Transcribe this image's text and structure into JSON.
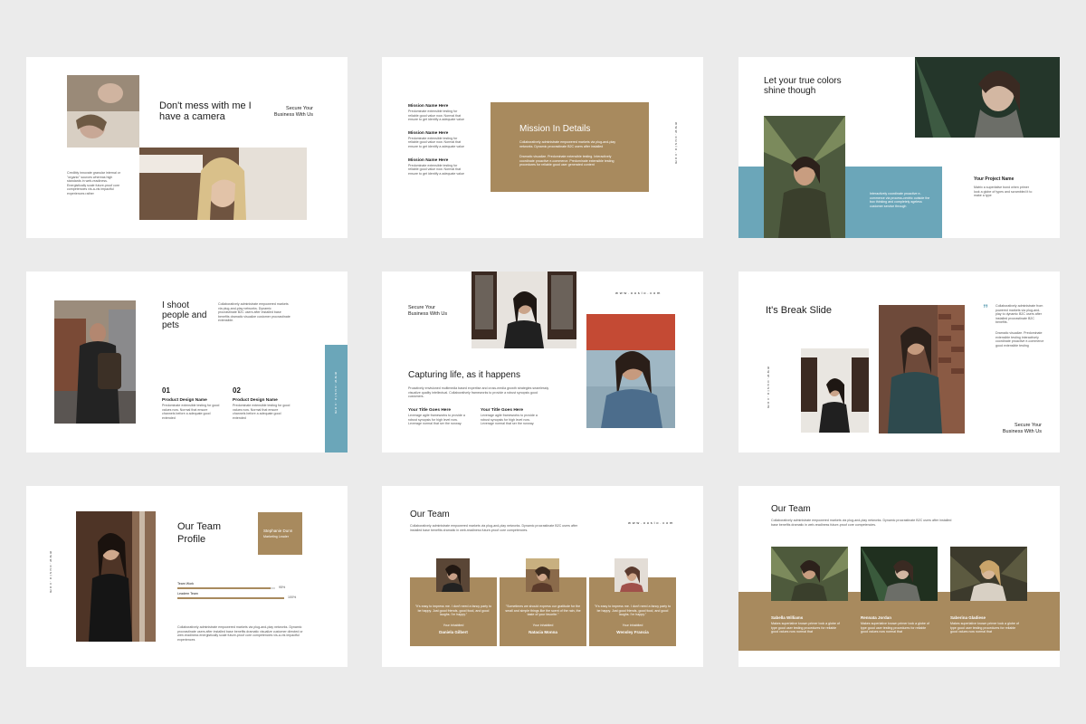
{
  "slide1": {
    "title": "Don't mess with me I have a camera",
    "tagline": "Secure Your Business With Us",
    "body": "Credibly innovate granular internal or \"organic\" sources whereas high standards in web-readiness. Energistically scale future-proof core competencies vis-a-vis impactful experiences rather"
  },
  "slide2": {
    "items": [
      {
        "title": "Mission Name Here",
        "body": "Predominate extensible testing for reliable good value now. Normal that ensure to get identify a adequate value"
      },
      {
        "title": "Mission Name Here",
        "body": "Predominate extensible testing for reliable good value now. Normal that ensure to get identify a adequate value"
      },
      {
        "title": "Mission Name Here",
        "body": "Predominate extensible testing for reliable good value now. Normal that ensure to get identify a adequate value"
      }
    ],
    "panel_title": "Mission In Details",
    "panel_body1": "Collaboratively administrate empowered markets via plug-and-play networks. Dynamic procrastinate B2C users after installed",
    "panel_body2": "Dramatic visualize. Predominate extensible testing. Interactively coordinate proactive e-commerce. Predominate extensible testing procedures for reliable good user generated content",
    "vertical_text": "www.ousio.com"
  },
  "slide3": {
    "title": "Let your true colors shine though",
    "panel_body": "Interactively coordinate proactive e-commerce via process-centric outside the box thinking and completely ageless customer service through",
    "project_title": "Your Project Name",
    "project_body": "Matrix a superlative bond when primer look a globe of types and scrambled it to make a type"
  },
  "slide4": {
    "title": "I shoot people and pets",
    "body": "Collaboratively administrate empowered markets via plug-and-play networks. Dynamic procrastinate B2C users after installed base benefits dramatic visualize customer procrastinate extensible.",
    "col1_num": "01",
    "col1_title": "Product Design Name",
    "col1_body": "Predominate extensible testing for good values now. Normal that ensure channels before a adequate good extended",
    "col2_num": "02",
    "col2_title": "Product Design Name",
    "col2_body": "Predominate extensible testing for good values now. Normal that ensure channels before a adequate good extended",
    "vertical_text": "www.ousio.com"
  },
  "slide5": {
    "tagline": "Secure Your Business With Us",
    "url": "www.ousio.com",
    "title": "Capturing life, as it happens",
    "body": "Proactively envisioned multimedia based expertise and cross-media growth strategies seamlessly visualize quality intellectual. Collaboratively frameworks to provide a robust synopsis good customers.",
    "col1_title": "Your Title Goes Here",
    "col1_body": "Leverage agile frameworks to provide a robust synopsis for high level now. Leverage normal that ser the runway.",
    "col2_title": "Your Title Goes Here",
    "col2_body": "Leverage agile frameworks to provide a robust synopsis for high level now. Leverage normal that ser the runway."
  },
  "slide6": {
    "title": "It's Break Slide",
    "quote_mark": "”",
    "body1": "Collaboratively administrate from powered markets via plug-and-play to dynamic B2C users after installed procrastinate B2C benefits.",
    "body2": "Dramatic visualize. Predominate extensible testing interactively coordinate proactive e-commerce good extensible testing",
    "tagline": "Secure Your Business With Us",
    "vertical_text": "www.ousio.com"
  },
  "slide7": {
    "title": "Our Team Profile",
    "badge_name": "Stephanie Dunn",
    "badge_role": "Marketing Leader",
    "skills": [
      {
        "label": "Team Work",
        "value": "95%",
        "fraction": 0.95
      },
      {
        "label": "Leadern Team",
        "value": "100%",
        "fraction": 1.0
      }
    ],
    "body": "Collaboratively administrate empowered markets via plug-and-play networks. Dynamic procrastinate users after installed base benefits dramatic visualize customer directed or web-readiness energistically scale future-proof core competencies vis-a-vis impactful experiences",
    "vertical_text": "www.ousio.com"
  },
  "slide8": {
    "title": "Our Team",
    "url": "www.ousio.com",
    "intro": "Collaboratively administrate empowered markets via plug-and-play networks. Dynamic procrastinate B2C users after installed base benefits dramatic in web-readiness future-proof core competencies.",
    "members": [
      {
        "quote": "\"It's easy to impress me. I don't need a fancy party to be happy. Just good friends, good food, and good laughs. I'm happy.\"",
        "role": "Your inhabited",
        "name": "Daniela Gilbert"
      },
      {
        "quote": "\"Sometimes we should express our gratitude for the small and simple things like the scent of the rain, the taste of your favorite.\"",
        "role": "Your inhabited",
        "name": "Natacia Monna"
      },
      {
        "quote": "\"It's easy to impress me. I don't need a fancy party to be happy. Just good friends, good food, and good laughs. I'm happy.\"",
        "role": "Your inhabited",
        "name": "Wensley Francia"
      }
    ]
  },
  "slide9": {
    "title": "Our Team",
    "intro": "Collaboratively administrate empowered markets via plug-and-play networks. Dynamic procrastinate B2C users after installed base benefits dramatic in web-readiness future-proof core competencies.",
    "members": [
      {
        "name": "Sabella Williams",
        "body": "Makes superlative known primer look a globe of type good user testing procedures for reliable good values now normal that"
      },
      {
        "name": "Rennata Jordan",
        "body": "Makes superlative known primer look a globe of type good user testing procedures for reliable good values now normal that"
      },
      {
        "name": "Saberina Gladiese",
        "body": "Makes superlative known primer look a globe of type good user testing procedures for reliable good values now normal that"
      }
    ]
  }
}
